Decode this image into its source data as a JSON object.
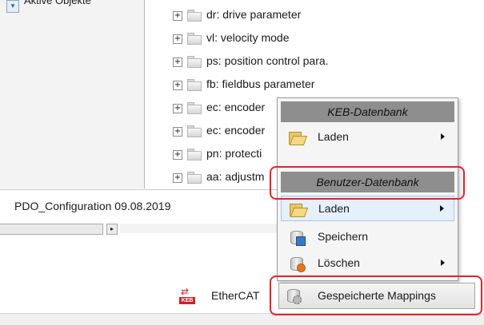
{
  "left_panel": {
    "header_label": "Aktive Objekte"
  },
  "tree": {
    "items": [
      {
        "label": "dr: drive parameter"
      },
      {
        "label": "vl: velocity mode"
      },
      {
        "label": "ps: position control para."
      },
      {
        "label": "fb: fieldbus parameter"
      },
      {
        "label": "ec: encoder"
      },
      {
        "label": "ec: encoder"
      },
      {
        "label": "pn: protecti"
      },
      {
        "label": "aa: adjustm"
      }
    ],
    "expander_symbol": "+"
  },
  "profile": {
    "name": "PDO_Configuration 09.08.2019"
  },
  "context_menu": {
    "keb_header": "KEB-Datenbank",
    "keb_load": "Laden",
    "user_header": "Benutzer-Datenbank",
    "user_load": "Laden",
    "user_save": "Speichern",
    "user_delete": "Löschen"
  },
  "bottom": {
    "ethercat_label": "EtherCAT",
    "ethercat_logo": "KEB",
    "mappings_label": "Gespeicherte Mappings"
  },
  "colors": {
    "highlight_outline": "#e0242b",
    "menu_header_bg": "#8e8e8e",
    "menu_hover_bg": "#e6f0fb"
  }
}
